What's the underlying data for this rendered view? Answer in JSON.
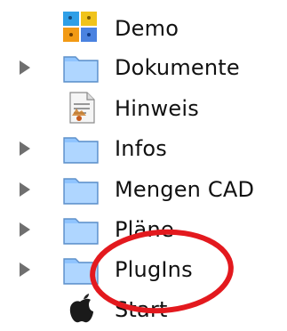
{
  "items": [
    {
      "label": "Demo",
      "icon": "demo-app-icon",
      "has_disclosure": false
    },
    {
      "label": "Dokumente",
      "icon": "folder-icon",
      "has_disclosure": true
    },
    {
      "label": "Hinweis",
      "icon": "document-icon",
      "has_disclosure": false
    },
    {
      "label": "Infos",
      "icon": "folder-icon",
      "has_disclosure": true
    },
    {
      "label": "Mengen CAD",
      "icon": "folder-icon",
      "has_disclosure": true
    },
    {
      "label": "Pläne",
      "icon": "folder-icon",
      "has_disclosure": true
    },
    {
      "label": "PlugIns",
      "icon": "folder-icon",
      "has_disclosure": true
    },
    {
      "label": "Start",
      "icon": "apple-logo-icon",
      "has_disclosure": false
    }
  ],
  "colors": {
    "folder_fill": "#8fc4ff",
    "folder_stroke": "#5f90c9",
    "disclosure": "#6f6f6f",
    "highlight_ring": "#e3191e"
  }
}
